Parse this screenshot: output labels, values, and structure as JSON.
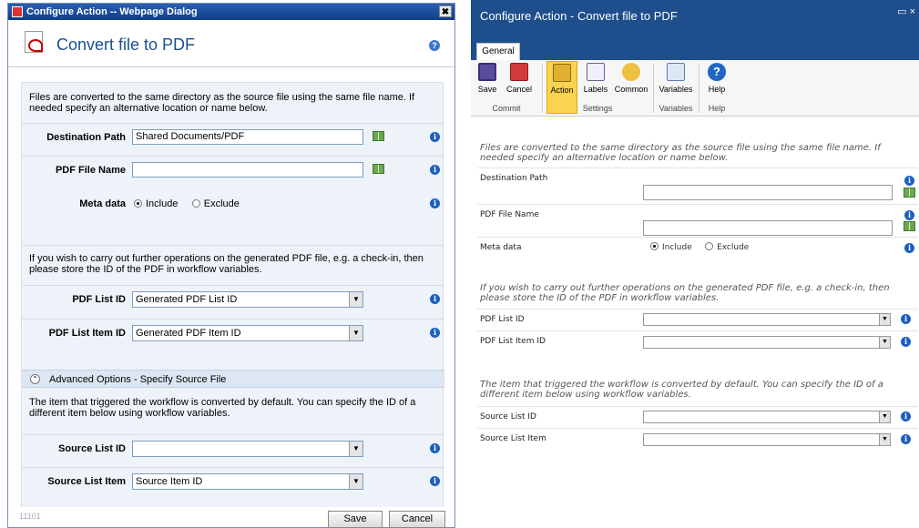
{
  "left": {
    "window_title": "Configure Action -- Webpage Dialog",
    "close_glyph": "✖",
    "heading": "Convert file to PDF",
    "help_glyph": "?",
    "info_glyph": "i",
    "intro": "Files are converted to the same directory as the source file using the same file name. If needed specify an alternative location or name below.",
    "destination_path": {
      "label": "Destination Path",
      "value": "Shared Documents/PDF"
    },
    "pdf_file_name": {
      "label": "PDF File Name",
      "value": ""
    },
    "meta_data": {
      "label": "Meta data",
      "include": "Include",
      "exclude": "Exclude",
      "selected": "Include"
    },
    "further_ops": "If you wish to carry out further operations on the generated PDF file, e.g. a check-in, then please store the ID of the PDF in workflow variables.",
    "pdf_list_id": {
      "label": "PDF List ID",
      "value": "Generated PDF List ID"
    },
    "pdf_list_item_id": {
      "label": "PDF List Item ID",
      "value": "Generated PDF Item ID"
    },
    "advanced_label": "Advanced Options - Specify Source File",
    "advanced_text": "The item that triggered the workflow is converted by default. You can specify the ID of a different item below using workflow variables.",
    "source_list_id": {
      "label": "Source List ID",
      "value": ""
    },
    "source_list_item": {
      "label": "Source List Item",
      "value": "Source Item ID"
    },
    "footer_code": "11101",
    "save": "Save",
    "cancel": "Cancel"
  },
  "right": {
    "window_title": "Configure Action - Convert file to PDF",
    "window_controls": "▭ ×",
    "tab": "General",
    "ribbon": {
      "save": "Save",
      "cancel": "Cancel",
      "action": "Action",
      "labels": "Labels",
      "common": "Common",
      "variables": "Variables",
      "help": "Help",
      "groups": {
        "commit": "Commit",
        "settings": "Settings",
        "variables": "Variables",
        "help": "Help"
      }
    },
    "intro": "Files are converted to the same directory as the source file using the same file name. If needed specify an alternative location or name below.",
    "destination_path": "Destination Path",
    "pdf_file_name": "PDF File Name",
    "meta_data": {
      "label": "Meta data",
      "include": "Include",
      "exclude": "Exclude",
      "selected": "Include"
    },
    "further_ops": "If you wish to carry out further operations on the generated PDF file, e.g. a check-in, then please store the ID of the PDF in workflow variables.",
    "pdf_list_id": "PDF List ID",
    "pdf_list_item_id": "PDF List Item ID",
    "advanced_text": "The item that triggered the workflow is converted by default. You can specify the ID of a different item below using workflow variables.",
    "source_list_id": "Source List ID",
    "source_list_item": "Source List Item"
  }
}
